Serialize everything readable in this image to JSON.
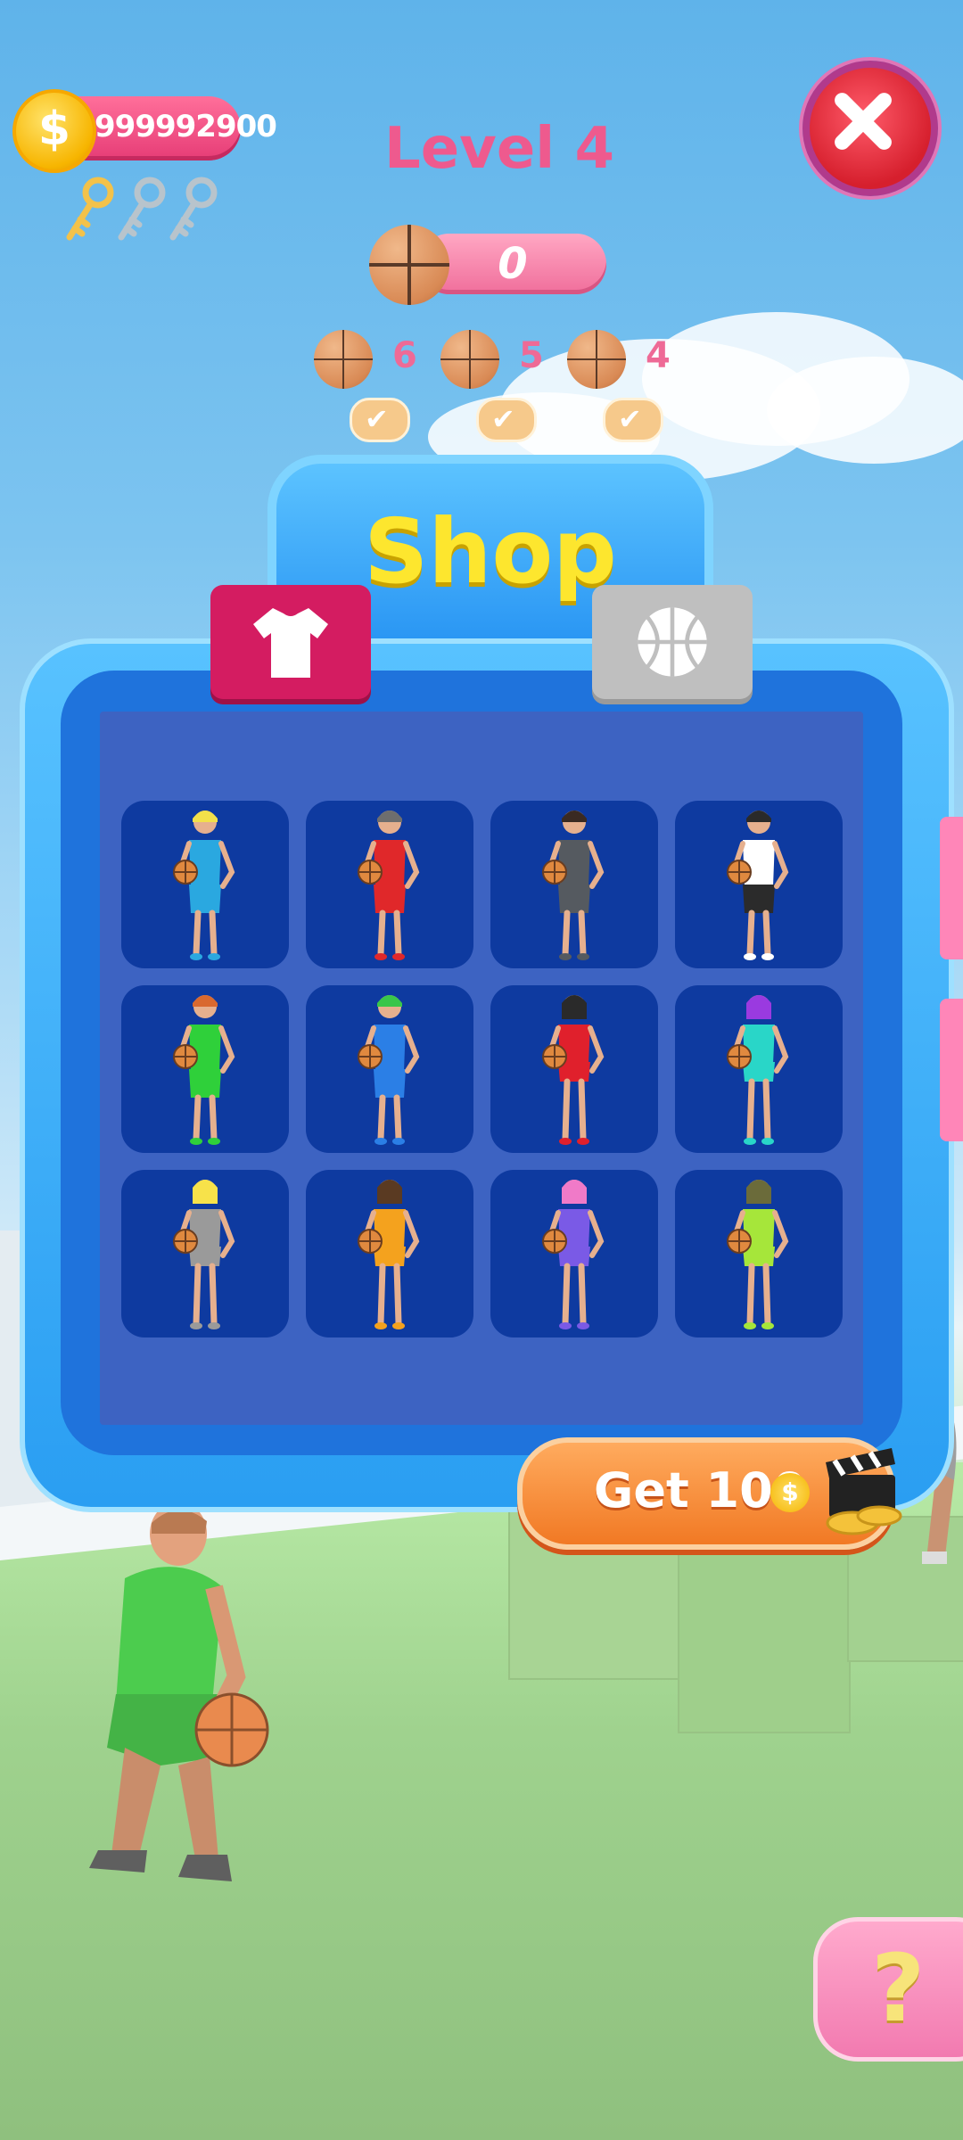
{
  "hud": {
    "coins": "999992900",
    "coin_symbol": "$",
    "keys_collected": 1,
    "keys_total": 3,
    "level": "Level 4",
    "score": "0"
  },
  "requirements": [
    {
      "count": "6",
      "done": true
    },
    {
      "count": "5",
      "done": true
    },
    {
      "count": "4",
      "done": true
    }
  ],
  "shop": {
    "title": "Shop",
    "tabs": [
      {
        "icon": "tshirt-icon",
        "active": true
      },
      {
        "icon": "basketball-icon",
        "active": false
      }
    ],
    "outfits": [
      {
        "hair": "#f2e04a",
        "top": "#2aa8e0",
        "bottom": "#2aa8e0",
        "style": "m"
      },
      {
        "hair": "#6e6e6e",
        "top": "#e0282a",
        "bottom": "#e0282a",
        "style": "m"
      },
      {
        "hair": "#3a2a22",
        "top": "#555a60",
        "bottom": "#555a60",
        "style": "m"
      },
      {
        "hair": "#2a2a2a",
        "top": "#ffffff",
        "bottom": "#2b2b2b",
        "style": "m"
      },
      {
        "hair": "#d9692f",
        "top": "#2fd03a",
        "bottom": "#2fd03a",
        "style": "m"
      },
      {
        "hair": "#39c64a",
        "top": "#2b7fe6",
        "bottom": "#2b7fe6",
        "style": "m"
      },
      {
        "hair": "#2a2a2a",
        "top": "#e0202c",
        "bottom": "#e0202c",
        "style": "f"
      },
      {
        "hair": "#9a3ae0",
        "top": "#29d6c8",
        "bottom": "#29d6c8",
        "style": "f"
      },
      {
        "hair": "#f7e24a",
        "top": "#9a9a9a",
        "bottom": "#9a9a9a",
        "style": "f"
      },
      {
        "hair": "#5a3a22",
        "top": "#f4a21e",
        "bottom": "#f4a21e",
        "style": "f"
      },
      {
        "hair": "#f07ac8",
        "top": "#7a5ae6",
        "bottom": "#7a5ae6",
        "style": "f"
      },
      {
        "hair": "#6b6b3a",
        "top": "#a6e63a",
        "bottom": "#a6e63a",
        "style": "f"
      }
    ],
    "get_button_label": "Get 100",
    "get_button_coin": "$"
  },
  "help_label": "?",
  "colors": {
    "accent_pink": "#ee5a8e",
    "shop_blue": "#1f73dc",
    "title_yellow": "#fde62e",
    "button_orange": "#f17924"
  }
}
